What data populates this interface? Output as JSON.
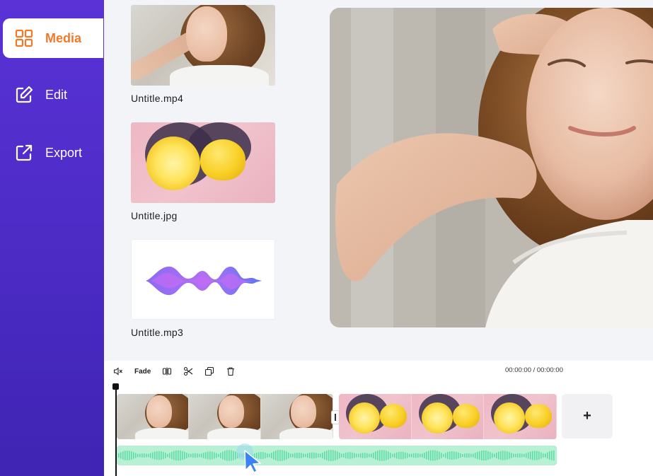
{
  "sidebar": {
    "items": [
      {
        "label": "Media",
        "icon": "grid-icon",
        "active": true
      },
      {
        "label": "Edit",
        "icon": "edit-icon",
        "active": false
      },
      {
        "label": "Export",
        "icon": "export-icon",
        "active": false
      }
    ],
    "accent": "#f07a2a",
    "background": "#4b2bc4"
  },
  "media": {
    "items": [
      {
        "name": "Untitle.mp4",
        "kind": "video"
      },
      {
        "name": "Untitle.jpg",
        "kind": "image"
      },
      {
        "name": "Untitle.mp3",
        "kind": "audio"
      }
    ]
  },
  "timeline": {
    "toolbar": {
      "mute_icon": "mute-icon",
      "fade_label": "Fade",
      "split_icon": "split-icon",
      "cut_icon": "scissors-icon",
      "duplicate_icon": "duplicate-icon",
      "delete_icon": "trash-icon"
    },
    "timecode": "00:00:00 / 00:00:00",
    "add_label": "+",
    "audio_color": "#5fdca6"
  }
}
